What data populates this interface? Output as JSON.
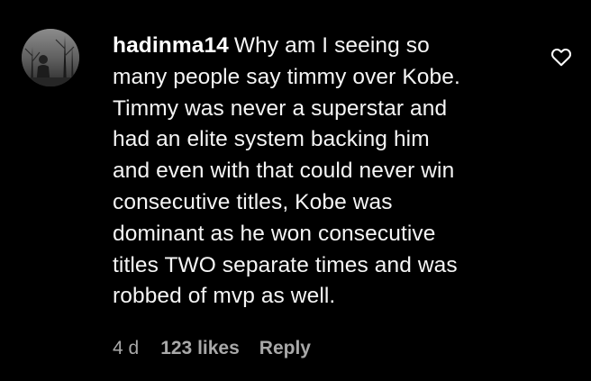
{
  "comment": {
    "username": "hadinma14",
    "lines": [
      "Why am I seeing so",
      "many people say timmy over Kobe.",
      "Timmy was never a superstar and",
      "had an elite system backing him",
      "and even with that could never win",
      "consecutive titles, Kobe was",
      "dominant as he won consecutive",
      "titles TWO separate times and was",
      "robbed of mvp as well."
    ],
    "time": "4 d",
    "likes": "123 likes",
    "reply_label": "Reply",
    "like_icon": "heart-outline-icon"
  },
  "colors": {
    "background": "#000000",
    "text": "#f5f5f5",
    "meta": "#a8a8a8"
  }
}
